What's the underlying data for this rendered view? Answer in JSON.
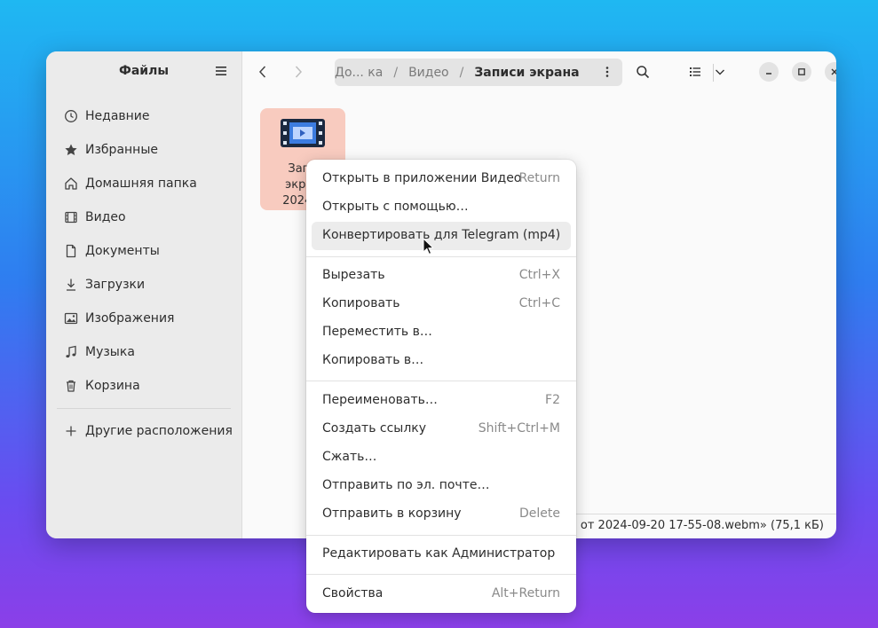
{
  "sidebar": {
    "title": "Файлы",
    "items": [
      {
        "label": "Недавние",
        "icon": "clock-icon"
      },
      {
        "label": "Избранные",
        "icon": "star-icon"
      },
      {
        "label": "Домашняя папка",
        "icon": "home-icon"
      },
      {
        "label": "Видео",
        "icon": "film-icon"
      },
      {
        "label": "Документы",
        "icon": "document-icon"
      },
      {
        "label": "Загрузки",
        "icon": "download-icon"
      },
      {
        "label": "Изображения",
        "icon": "image-icon"
      },
      {
        "label": "Музыка",
        "icon": "music-icon"
      },
      {
        "label": "Корзина",
        "icon": "trash-icon"
      }
    ],
    "other_locations": "Другие расположения"
  },
  "pathbar": {
    "home": "До... ка",
    "sep": "/",
    "video": "Видео",
    "current": "Записи экрана"
  },
  "file": {
    "line1": "Запи",
    "line2": "экран",
    "line3": "2024..."
  },
  "status": {
    "text": "а от 2024-09-20 17-55-08.webm»  (75,1 кБ)"
  },
  "menu": {
    "open_video": {
      "label": "Открыть в приложении Видео",
      "accel": "Return"
    },
    "open_with": {
      "label": "Открыть с помощью…"
    },
    "convert": {
      "label": "Конвертировать для Telegram (mp4)"
    },
    "cut": {
      "label": "Вырезать",
      "accel": "Ctrl+X"
    },
    "copy": {
      "label": "Копировать",
      "accel": "Ctrl+C"
    },
    "move_to": {
      "label": "Переместить в…"
    },
    "copy_to": {
      "label": "Копировать в…"
    },
    "rename": {
      "label": "Переименовать…",
      "accel": "F2"
    },
    "link": {
      "label": "Создать ссылку",
      "accel": "Shift+Ctrl+M"
    },
    "compress": {
      "label": "Сжать…"
    },
    "email": {
      "label": "Отправить по эл. почте…"
    },
    "trash": {
      "label": "Отправить в корзину",
      "accel": "Delete"
    },
    "admin": {
      "label": "Редактировать как Администратор"
    },
    "props": {
      "label": "Свойства",
      "accel": "Alt+Return"
    }
  }
}
